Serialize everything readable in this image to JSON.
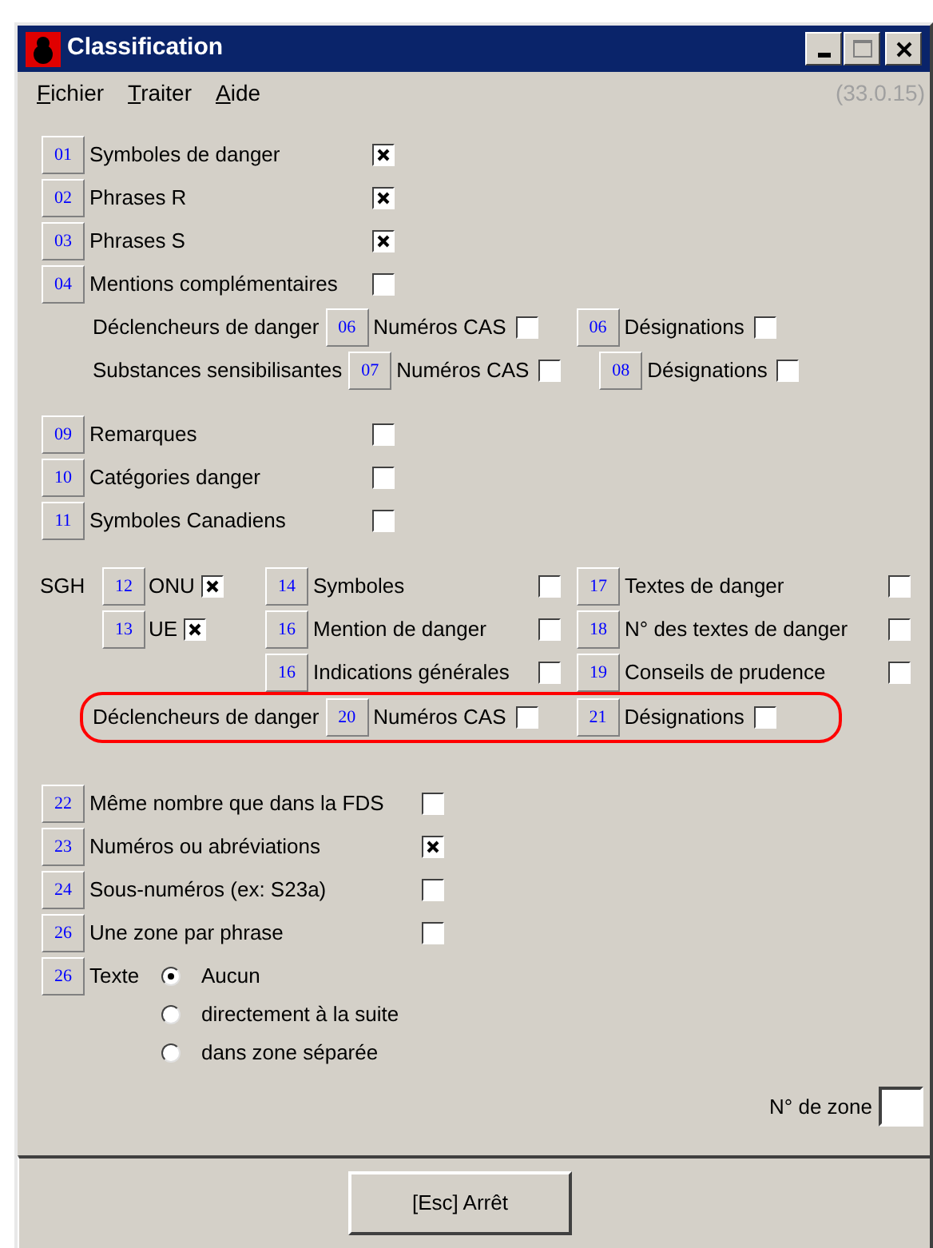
{
  "window": {
    "title": "Classification"
  },
  "menu": [
    {
      "label": "Fichier"
    },
    {
      "label": "Traiter"
    },
    {
      "label": "Aide"
    }
  ],
  "version": "(33.0.15)",
  "options_1": [
    {
      "number": "01",
      "label": "Symboles de danger",
      "checked": true
    },
    {
      "number": "02",
      "label": "Phrases R",
      "checked": true
    },
    {
      "number": "03",
      "label": "Phrases S",
      "checked": true
    },
    {
      "number": "04",
      "label": "Mentions complémentaires",
      "checked": false
    }
  ],
  "sub_rows": [
    {
      "label": "Déclencheurs de danger",
      "items": [
        {
          "number": "06",
          "label": "Numéros CAS",
          "checked": false
        },
        {
          "number": "06",
          "label": "Désignations",
          "checked": false
        }
      ]
    },
    {
      "label": "Substances sensibilisantes",
      "items": [
        {
          "number": "07",
          "label": "Numéros CAS",
          "checked": false
        },
        {
          "number": "08",
          "label": "Désignations",
          "checked": false
        }
      ]
    }
  ],
  "options_2": [
    {
      "number": "09",
      "label": "Remarques",
      "checked": false
    },
    {
      "number": "10",
      "label": "Catégories danger",
      "checked": false
    },
    {
      "number": "11",
      "label": "Symboles Canadiens",
      "checked": false
    }
  ],
  "sgh": {
    "label": "SGH",
    "regions": [
      {
        "number": "12",
        "label": "ONU",
        "checked": true
      },
      {
        "number": "13",
        "label": "UE",
        "checked": true
      }
    ],
    "columns": [
      [
        {
          "number": "14",
          "label": "Symboles",
          "checked": false
        },
        {
          "number": "16",
          "label": "Mention de danger",
          "checked": false
        },
        {
          "number": "16",
          "label": "Indications générales",
          "checked": false
        }
      ],
      [
        {
          "number": "17",
          "label": "Textes de danger",
          "checked": false
        },
        {
          "number": "18",
          "label": "N° des textes de danger",
          "checked": false
        },
        {
          "number": "19",
          "label": "Conseils de prudence",
          "checked": false
        }
      ]
    ],
    "highlighted_row": {
      "label": "Déclencheurs de danger",
      "items": [
        {
          "number": "20",
          "label": "Numéros CAS",
          "checked": false
        },
        {
          "number": "21",
          "label": "Désignations",
          "checked": false
        }
      ]
    }
  },
  "options_3": [
    {
      "number": "22",
      "label": "Même nombre que dans la FDS",
      "checked": false
    },
    {
      "number": "23",
      "label": "Numéros ou abréviations",
      "checked": true
    },
    {
      "number": "24",
      "label": "Sous-numéros (ex: S23a)",
      "checked": false
    },
    {
      "number": "26",
      "label": "Une zone par phrase",
      "checked": false
    }
  ],
  "text_option": {
    "number": "26",
    "label": "Texte",
    "choices": [
      {
        "label": "Aucun",
        "selected": true
      },
      {
        "label": "directement à la suite",
        "selected": false
      },
      {
        "label": "dans zone séparée",
        "selected": false
      }
    ]
  },
  "zone": {
    "label": "N° de zone"
  },
  "button": "[Esc] Arrêt"
}
